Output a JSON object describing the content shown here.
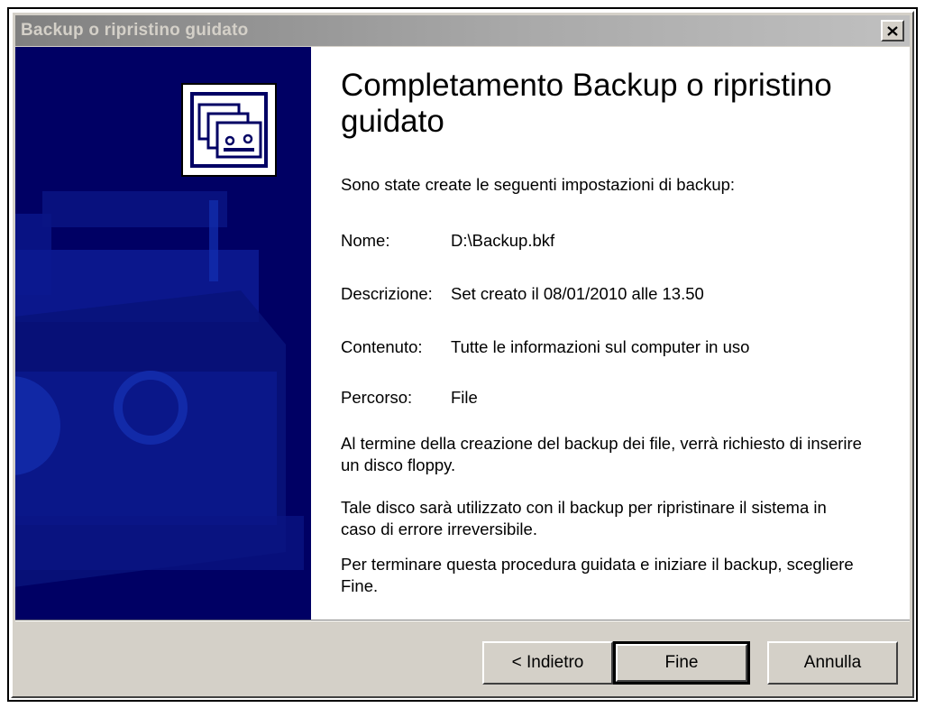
{
  "window": {
    "title": "Backup o ripristino guidato"
  },
  "wizard": {
    "heading": "Completamento Backup o ripristino guidato",
    "intro": "Sono state create le seguenti impostazioni di backup:",
    "settings": [
      {
        "label": "Nome:",
        "value": "D:\\Backup.bkf"
      },
      {
        "label": "Descrizione:",
        "value": "Set creato il 08/01/2010 alle 13.50"
      },
      {
        "label": "Contenuto:",
        "value": "Tutte le informazioni sul computer in uso"
      },
      {
        "label": "Percorso:",
        "value": "File"
      }
    ],
    "paragraphs": [
      "Al termine della creazione del backup dei file, verrà richiesto di inserire un disco floppy.",
      "Tale disco sarà utilizzato con il backup per ripristinare il sistema in caso di errore irreversibile.",
      "Per terminare questa procedura guidata e iniziare il backup, scegliere Fine."
    ]
  },
  "buttons": {
    "back": "< Indietro",
    "finish": "Fine",
    "cancel": "Annulla"
  },
  "icons": {
    "wizard_icon": "backup-tapes-icon",
    "close": "close-icon"
  },
  "colors": {
    "side_panel": "#000064",
    "dialog_face": "#d4d0c8"
  }
}
